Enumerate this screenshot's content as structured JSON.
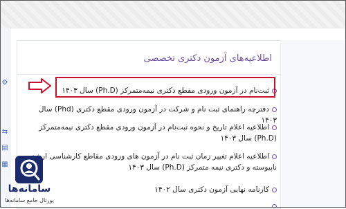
{
  "panel": {
    "title": "اطلاعیه‌های آزمون دکتری تخصصی"
  },
  "news": {
    "items": [
      {
        "text": "ثبت‌نام در آزمون ورودی مقطع دکتری نیمه‌متمرکز (Ph.D) سال ۱۴۰۳"
      },
      {
        "text": "دفترچه راهنمای ثبت نام و شرکت در آزمون ورودی مقطع دکتری (Phd) سال ۱۴۰۳"
      },
      {
        "text": "اطلاعیه اعلام تاریخ و نحوه ثبت‌نام در آزمون ورودی مقطع دکتری نیمه‌متمرکز (Ph.D) سال ۱۴۰۳"
      },
      {
        "text": "اطلاعیه اعلام تغییر زمان ثبت نام در آزمون های ورودی مقاطع کارشناسی ارشد ناپیوسته و دکتری نیمه متمرکز (Ph.D) سال ۱۴۰۳"
      },
      {
        "text": "کارنامه نهایی آزمون دکتری سال ۱۴۰۲"
      }
    ]
  },
  "logo": {
    "name": "سامانه‌ها",
    "subtitle": "پورتال جامع سامانه‌ها"
  },
  "colors": {
    "accent": "#6a4fa0",
    "highlight": "#c8102e",
    "brand": "#1b2a6b"
  }
}
